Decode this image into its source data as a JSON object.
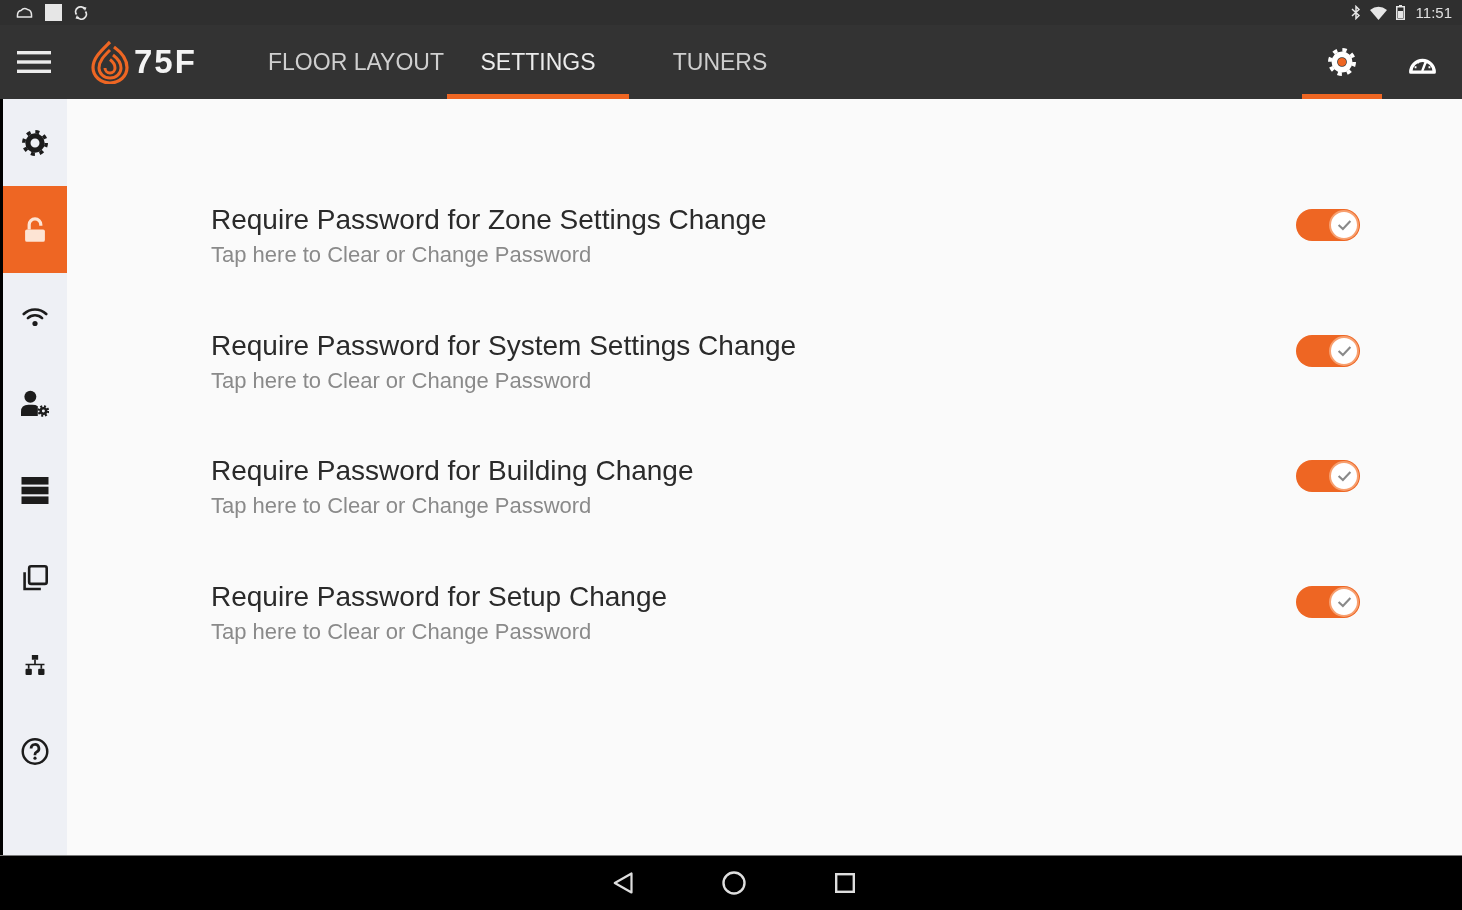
{
  "status_bar": {
    "time": "11:51"
  },
  "app_bar": {
    "logo_text": "75F",
    "tabs": [
      {
        "label": "FLOOR LAYOUT",
        "selected": false
      },
      {
        "label": "SETTINGS",
        "selected": true
      },
      {
        "label": "TUNERS",
        "selected": false
      }
    ],
    "actions": [
      {
        "kind": "settings",
        "selected": true
      },
      {
        "kind": "dashboard",
        "selected": false
      }
    ]
  },
  "sidebar": {
    "items": [
      {
        "kind": "settings",
        "selected": false
      },
      {
        "kind": "security",
        "selected": true
      },
      {
        "kind": "wifi",
        "selected": false
      },
      {
        "kind": "user_settings",
        "selected": false
      },
      {
        "kind": "server",
        "selected": false
      },
      {
        "kind": "copy",
        "selected": false
      },
      {
        "kind": "network",
        "selected": false
      },
      {
        "kind": "help",
        "selected": false
      }
    ]
  },
  "settings": [
    {
      "title": "Require Password for Zone Settings Change",
      "hint": "Tap here to Clear or Change Password",
      "on": true
    },
    {
      "title": "Require Password for System Settings Change",
      "hint": "Tap here to Clear or Change Password",
      "on": true
    },
    {
      "title": "Require Password for Building Change",
      "hint": "Tap here to Clear or Change Password",
      "on": true
    },
    {
      "title": "Require Password for Setup Change",
      "hint": "Tap here to Clear or Change Password",
      "on": true
    }
  ]
}
